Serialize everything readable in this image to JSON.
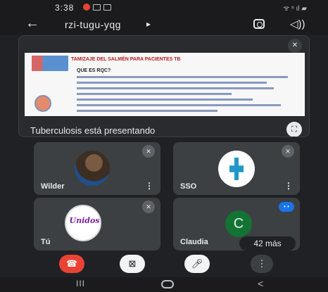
{
  "status_bar": {
    "time": "3:38",
    "right_text": "ᯤ ⁿ ıl ▰"
  },
  "header": {
    "meeting_code": "rzi-tugu-yqg",
    "caret": "▸",
    "back": "←",
    "speaker": "◁))"
  },
  "presentation": {
    "slide_title": "TAMIZAJE DEL SALMÉN PARA PACIENTES TB",
    "slide_subheading": "QUE ES RQC?",
    "presenter_label": "Tuberculosis está presentando",
    "expand_glyph": "⛶"
  },
  "participants": [
    {
      "name": "Wilder",
      "more": "⋮"
    },
    {
      "name": "SSO",
      "more": "⋮"
    },
    {
      "name": "Tú",
      "avatar_text": "Unidos"
    },
    {
      "name": "Claudia",
      "initial": "C"
    }
  ],
  "more_participants": "42 más",
  "controls": {
    "end_call": "☎",
    "camera": "⊠",
    "mic": "🎤︎",
    "more": "⋮"
  },
  "nav": {
    "recents": "III",
    "back": "<"
  },
  "colors": {
    "end_call": "#ea4335",
    "badge": "#1a73e8",
    "claudia_avatar": "#137333"
  }
}
